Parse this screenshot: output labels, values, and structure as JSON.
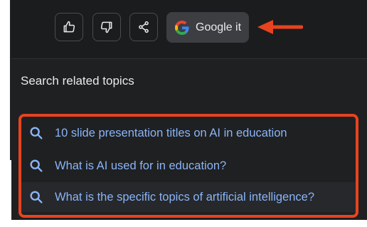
{
  "toolbar": {
    "google_button_label": "Google it"
  },
  "related": {
    "title": "Search related topics",
    "items": [
      "10 slide presentation titles on AI in education",
      "What is AI used for in education?",
      "What is the specific topics of artificial intelligence?"
    ]
  },
  "icons": [
    "thumbs-up-icon",
    "thumbs-down-icon",
    "share-icon",
    "google-logo-icon",
    "search-icon"
  ],
  "colors": {
    "panel_background": "#1f2021",
    "link_text": "#8ab4f8",
    "annotation": "#e8431f"
  }
}
